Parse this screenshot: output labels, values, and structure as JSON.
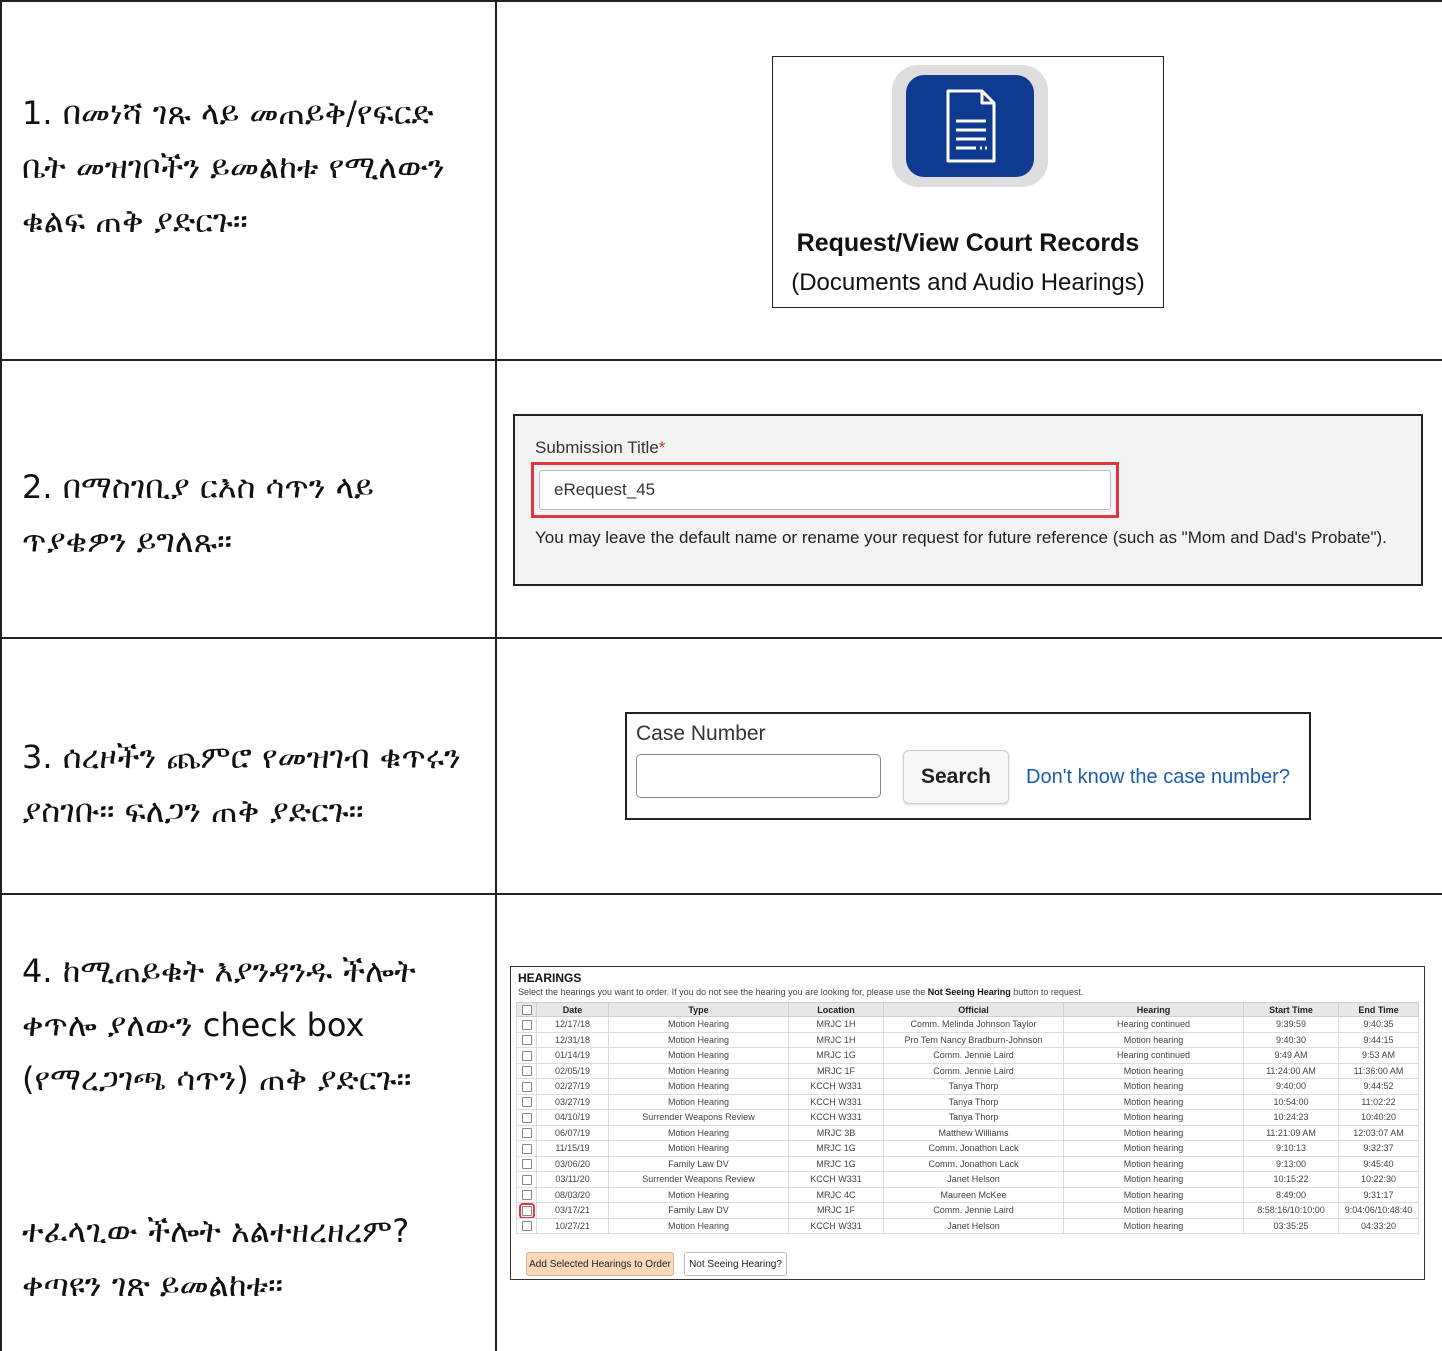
{
  "steps": [
    {
      "text": "1.   በመነሻ ገጹ ላይ መጠይቅ/የፍርድ ቤት መዝገቦችን ይመልከቱ የሚለውን ቁልፍ ጠቅ ያድርጉ።"
    },
    {
      "text": "2.   በማስገቢያ ርእስ ሳጥን ላይ ጥያቄዎን ይግለጹ።"
    },
    {
      "text": "3.   ሰረዞችን ጨምሮ የመዝገብ ቁጥሩን ያስገቡ። ፍለጋን ጠቅ ያድርጉ።"
    },
    {
      "text": "4.   ከሚጠይቁት እያንዳንዱ ችሎት ቀጥሎ ያለውን check box (የማረጋገጫ ሳጥን) ጠቅ ያድርጉ።",
      "note": "ተፈላጊው ችሎት አልተዘረዘረም? ቀጣዩን ገጽ ይመልከቱ።"
    }
  ],
  "panel1": {
    "title": "Request/View Court Records",
    "subtitle": "(Documents and Audio Hearings)",
    "icon": "document-icon",
    "tile_color": "#0e3a8f"
  },
  "panel2": {
    "label": "Submission Title",
    "required_mark": "*",
    "value": "eRequest_45",
    "help": "You may leave the default name or rename your request for future reference (such as \"Mom and Dad's Probate\").",
    "highlight_color": "#e0353d"
  },
  "panel3": {
    "label": "Case Number",
    "value": "",
    "search_label": "Search",
    "link_text": "Don't know the case number?"
  },
  "panel4": {
    "title": "HEARINGS",
    "inst_pre": "Select the hearings you want to order. If you do not see the hearing you are looking for, please use the ",
    "inst_bold": "Not Seeing Hearing",
    "inst_post": " button to request.",
    "columns": [
      "Date",
      "Type",
      "Location",
      "Official",
      "Hearing",
      "Start Time",
      "End Time"
    ],
    "rows": [
      [
        "12/17/18",
        "Motion Hearing",
        "MRJC 1H",
        "Comm. Melinda Johnson Taylor",
        "Hearing continued",
        "9:39:59",
        "9:40:35"
      ],
      [
        "12/31/18",
        "Motion Hearing",
        "MRJC 1H",
        "Pro Tem Nancy Bradburn-Johnson",
        "Motion hearing",
        "9:40:30",
        "9:44:15"
      ],
      [
        "01/14/19",
        "Motion Hearing",
        "MRJC 1G",
        "Comm. Jennie Laird",
        "Hearing continued",
        "9:49 AM",
        "9:53 AM"
      ],
      [
        "02/05/19",
        "Motion Hearing",
        "MRJC 1F",
        "Comm. Jennie Laird",
        "Motion hearing",
        "11:24:00 AM",
        "11:36:00 AM"
      ],
      [
        "02/27/19",
        "Motion Hearing",
        "KCCH W331",
        "Tanya Thorp",
        "Motion hearing",
        "9:40:00",
        "9:44:52"
      ],
      [
        "03/27/19",
        "Motion Hearing",
        "KCCH W331",
        "Tanya Thorp",
        "Motion hearing",
        "10:54:00",
        "11:02:22"
      ],
      [
        "04/10/19",
        "Surrender Weapons Review",
        "KCCH W331",
        "Tanya Thorp",
        "Motion hearing",
        "10:24:23",
        "10:40:20"
      ],
      [
        "06/07/19",
        "Motion Hearing",
        "MRJC 3B",
        "Matthew Williams",
        "Motion hearing",
        "11:21:09 AM",
        "12:03:07 AM"
      ],
      [
        "11/15/19",
        "Motion Hearing",
        "MRJC 1G",
        "Comm. Jonathon Lack",
        "Motion hearing",
        "9:10:13",
        "9:32:37"
      ],
      [
        "03/06/20",
        "Family Law DV",
        "MRJC 1G",
        "Comm. Jonathon Lack",
        "Motion hearing",
        "9:13:00",
        "9:45:40"
      ],
      [
        "03/11/20",
        "Surrender Weapons Review",
        "KCCH W331",
        "Janet Helson",
        "Motion hearing",
        "10:15:22",
        "10:22:30"
      ],
      [
        "08/03/20",
        "Motion Hearing",
        "MRJC 4C",
        "Maureen McKee",
        "Motion hearing",
        "8:49:00",
        "9:31:17"
      ],
      [
        "03/17/21",
        "Family Law DV",
        "MRJC 1F",
        "Comm. Jennie Laird",
        "Motion hearing",
        "8:58:16/10:10:00",
        "9:04:06/10:48:40"
      ],
      [
        "10/27/21",
        "Motion Hearing",
        "KCCH W331",
        "Janet Helson",
        "Motion hearing",
        "03:35:25",
        "04:33:20"
      ]
    ],
    "highlighted_row": 12,
    "add_button": "Add Selected Hearings to Order",
    "not_seeing_button": "Not Seeing Hearing?",
    "add_button_color": "#f9d9b7"
  }
}
